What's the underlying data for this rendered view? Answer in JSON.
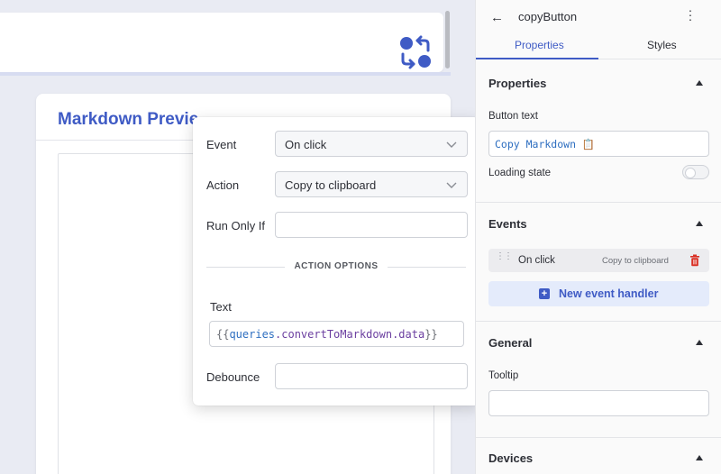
{
  "canvas": {
    "markdown_title": "Markdown Previe"
  },
  "event_popup": {
    "event_label": "Event",
    "event_value": "On click",
    "action_label": "Action",
    "action_value": "Copy to clipboard",
    "run_only_if_label": "Run Only If",
    "run_only_if_value": "",
    "options_header": "ACTION OPTIONS",
    "text_label": "Text",
    "text_code": {
      "open": "{{",
      "queries": "queries",
      "rest": ".convertToMarkdown.data",
      "close": "}}"
    },
    "debounce_label": "Debounce",
    "debounce_value": ""
  },
  "inspector": {
    "back_icon": "arrow-left-icon",
    "component_name": "copyButton",
    "more_icon": "kebab-menu-icon",
    "tabs": [
      {
        "label": "Properties",
        "active": true
      },
      {
        "label": "Styles",
        "active": false
      }
    ],
    "properties": {
      "title": "Properties",
      "button_text_label": "Button text",
      "button_text_value": "Copy Markdown 📋",
      "loading_state_label": "Loading state",
      "loading_state": false
    },
    "events": {
      "title": "Events",
      "items": [
        {
          "event": "On click",
          "action": "Copy to clipboard"
        }
      ],
      "new_handler_label": "New event handler"
    },
    "general": {
      "title": "General",
      "tooltip_label": "Tooltip",
      "tooltip_value": ""
    },
    "devices": {
      "title": "Devices"
    }
  },
  "colors": {
    "accent": "#3f5bc5",
    "canvas_bg": "#e9ebf3",
    "danger": "#d93025"
  }
}
